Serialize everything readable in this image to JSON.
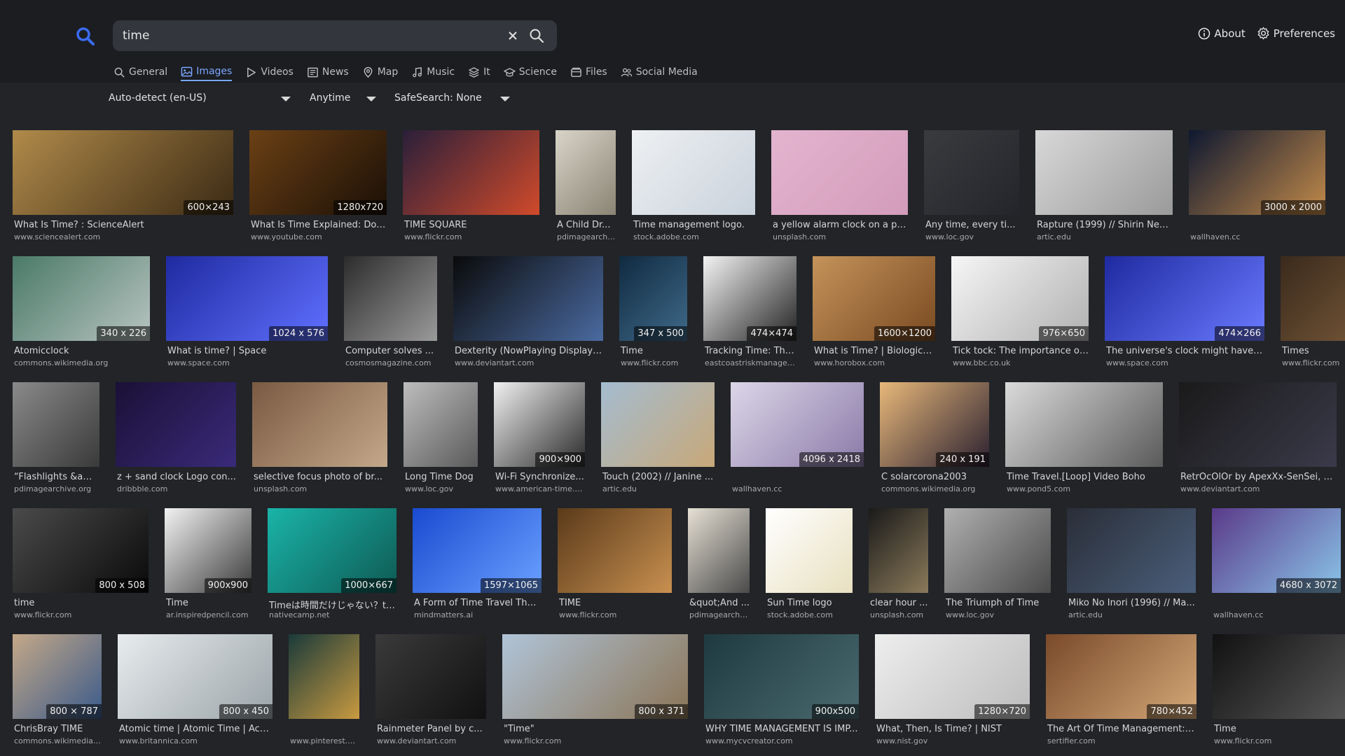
{
  "search": {
    "query": "time",
    "placeholder": ""
  },
  "top_links": {
    "about": "About",
    "preferences": "Preferences"
  },
  "tabs": [
    "General",
    "Images",
    "Videos",
    "News",
    "Map",
    "Music",
    "It",
    "Science",
    "Files",
    "Social Media"
  ],
  "active_tab": "Images",
  "filters": {
    "language": "Auto-detect (en-US)",
    "time": "Anytime",
    "safesearch": "SafeSearch: None"
  },
  "colors": {
    "accent": "#7ba6ff",
    "logo": "#3b6bf0"
  },
  "results": [
    {
      "title": "What Is Time? : ScienceAlert",
      "url": "www.sciencealert.com",
      "resolution": "600×243"
    },
    {
      "title": "What Is Time Explained: Does It R...",
      "url": "www.youtube.com",
      "resolution": "1280x720"
    },
    {
      "title": "TIME SQUARE",
      "url": "www.flickr.com",
      "resolution": ""
    },
    {
      "title": "A Child Dr...",
      "url": "pdimagearchiv...",
      "resolution": ""
    },
    {
      "title": "Time management logo.",
      "url": "stock.adobe.com",
      "resolution": ""
    },
    {
      "title": "a yellow alarm clock on a pi...",
      "url": "unsplash.com",
      "resolution": ""
    },
    {
      "title": "Any time, every ti...",
      "url": "www.loc.gov",
      "resolution": ""
    },
    {
      "title": "Rapture (1999) // Shirin Nes...",
      "url": "artic.edu",
      "resolution": ""
    },
    {
      "title": "",
      "url": "wallhaven.cc",
      "resolution": "3000 x 2000"
    },
    {
      "title": "Atomicclock",
      "url": "commons.wikimedia.org",
      "resolution": "340 x 226"
    },
    {
      "title": "What is time? | Space",
      "url": "www.space.com",
      "resolution": "1024 x 576"
    },
    {
      "title": "Computer solves ...",
      "url": "cosmosmagazine.com",
      "resolution": ""
    },
    {
      "title": "Dexterity (NowPlaying Display ...",
      "url": "www.deviantart.com",
      "resolution": ""
    },
    {
      "title": "Time",
      "url": "www.flickr.com",
      "resolution": "347 x 500"
    },
    {
      "title": "Tracking Time: The...",
      "url": "eastcoastriskmanageme...",
      "resolution": "474×474"
    },
    {
      "title": "What is Time? | Biologica...",
      "url": "www.horobox.com",
      "resolution": "1600×1200"
    },
    {
      "title": "Tick tock: The importance of...",
      "url": "www.bbc.co.uk",
      "resolution": "976×650"
    },
    {
      "title": "The universe's clock might have ...",
      "url": "www.space.com",
      "resolution": "474×266"
    },
    {
      "title": "Times",
      "url": "www.flickr.com",
      "resolution": ""
    },
    {
      "title": "“Flashlights &am...",
      "url": "pdimagearchive.org",
      "resolution": ""
    },
    {
      "title": "z + sand clock Logo con...",
      "url": "dribbble.com",
      "resolution": ""
    },
    {
      "title": "selective focus photo of br...",
      "url": "unsplash.com",
      "resolution": ""
    },
    {
      "title": "Long Time Dog",
      "url": "www.loc.gov",
      "resolution": ""
    },
    {
      "title": "Wi-Fi Synchronize...",
      "url": "www.american-time.com",
      "resolution": "900×900"
    },
    {
      "title": "Touch (2002) // Janine ...",
      "url": "artic.edu",
      "resolution": ""
    },
    {
      "title": "",
      "url": "wallhaven.cc",
      "resolution": "4096 x 2418"
    },
    {
      "title": "C solarcorona2003",
      "url": "commons.wikimedia.org",
      "resolution": "240 x 191"
    },
    {
      "title": "Time Travel.[Loop] Video Boho",
      "url": "www.pond5.com",
      "resolution": ""
    },
    {
      "title": "RetrOcOlOr by ApexXx-SenSei, v...",
      "url": "www.deviantart.com",
      "resolution": ""
    },
    {
      "title": "time",
      "url": "www.flickr.com",
      "resolution": "800 x 508"
    },
    {
      "title": "Time",
      "url": "ar.inspiredpencil.com",
      "resolution": "900x900"
    },
    {
      "title": "Timeは時間だけじゃない？ti...",
      "url": "nativecamp.net",
      "resolution": "1000×667"
    },
    {
      "title": "A Form of Time Travel That...",
      "url": "mindmatters.ai",
      "resolution": "1597×1065"
    },
    {
      "title": "TIME",
      "url": "www.flickr.com",
      "resolution": ""
    },
    {
      "title": "&quot;And ...",
      "url": "pdimagearchiv...",
      "resolution": ""
    },
    {
      "title": "Sun Time logo",
      "url": "stock.adobe.com",
      "resolution": ""
    },
    {
      "title": "clear hour ...",
      "url": "unsplash.com",
      "resolution": ""
    },
    {
      "title": "The Triumph of Time",
      "url": "www.loc.gov",
      "resolution": ""
    },
    {
      "title": "Miko No Inori (1996) // Ma...",
      "url": "artic.edu",
      "resolution": ""
    },
    {
      "title": "",
      "url": "wallhaven.cc",
      "resolution": "4680 x 3072"
    },
    {
      "title": "ChrisBray TIME",
      "url": "commons.wikimedia.org",
      "resolution": "800 × 787"
    },
    {
      "title": "Atomic time | Atomic Time | Acc...",
      "url": "www.britannica.com",
      "resolution": "800 x 450"
    },
    {
      "title": "",
      "url": "www.pinterest.com",
      "resolution": ""
    },
    {
      "title": "Rainmeter Panel by c...",
      "url": "www.deviantart.com",
      "resolution": ""
    },
    {
      "title": "\"Time\"",
      "url": "www.flickr.com",
      "resolution": "800 x 371"
    },
    {
      "title": "WHY TIME MANAGEMENT IS IMP...",
      "url": "www.mycvcreator.com",
      "resolution": "900x500"
    },
    {
      "title": "What, Then, Is Time? | NIST",
      "url": "www.nist.gov",
      "resolution": "1280×720"
    },
    {
      "title": "The Art Of Time Management: ...",
      "url": "sertifier.com",
      "resolution": "780×452"
    },
    {
      "title": "Time",
      "url": "www.flickr.com",
      "resolution": ""
    }
  ]
}
